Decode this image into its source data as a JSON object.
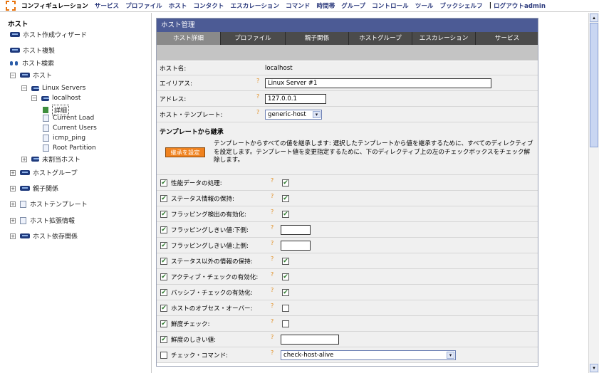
{
  "nav": {
    "items": [
      "コンフィギュレーション",
      "サービス",
      "プロファイル",
      "ホスト",
      "コンタクト",
      "エスカレーション",
      "コマンド",
      "時間帯",
      "グループ",
      "コントロール",
      "ツール",
      "ブックシェルフ"
    ],
    "logout": "ログアウトadmin"
  },
  "sidebar": {
    "title": "ホスト",
    "items": {
      "wizard": "ホスト作成ウィザード",
      "clone": "ホスト複製",
      "search": "ホスト検索",
      "host": "ホスト",
      "linux_servers": "Linux Servers",
      "localhost": "localhost",
      "detail": "詳細",
      "svc1": "Current Load",
      "svc2": "Current Users",
      "svc3": "icmp_ping",
      "svc4": "Root Partition",
      "unassigned": "未割当ホスト",
      "hostgroups": "ホストグループ",
      "parents": "親子関係",
      "templates": "ホストテンプレート",
      "extinfo": "ホスト拡張情報",
      "deps": "ホスト依存関係"
    }
  },
  "main": {
    "header": "ホスト管理",
    "tabs": [
      "ホスト詳細",
      "プロファイル",
      "親子関係",
      "ホストグループ",
      "エスカレーション",
      "サービス"
    ],
    "hostname_label": "ホスト名:",
    "hostname_value": "localhost",
    "alias_label": "エイリアス:",
    "alias_value": "Linux Server #1",
    "address_label": "アドレス:",
    "address_value": "127.0.0.1",
    "template_label": "ホスト・テンプレート:",
    "template_value": "generic-host",
    "inherit_title": "テンプレートから継承",
    "inherit_button": "継承を設定",
    "inherit_desc": "テンプレートからすべての値を継承します: 選択したテンプレートから値を継承するために、すべてのディレクティブを設定します。テンプレート値を変更指定するために、下のディレクティブ上の左のチェックボックスをチェック解除します。",
    "directives": [
      {
        "label": "性能データの処理:",
        "left": "✔",
        "right": "✔"
      },
      {
        "label": "ステータス情報の保持:",
        "left": "✔",
        "right": "✔"
      },
      {
        "label": "フラッピング検出の有効化:",
        "left": "✔",
        "right": "✔"
      },
      {
        "label": "フラッピングしきい値:下側:",
        "left": "✔",
        "right": ""
      },
      {
        "label": "フラッピングしきい値:上側:",
        "left": "✔",
        "right": ""
      },
      {
        "label": "ステータス以外の情報の保持:",
        "left": "✔",
        "right": "✔"
      },
      {
        "label": "アクティブ・チェックの有効化:",
        "left": "✔",
        "right": "✔"
      },
      {
        "label": "パッシブ・チェックの有効化:",
        "left": "✔",
        "right": "✔"
      },
      {
        "label": "ホストのオブセス・オーバー:",
        "left": "✔",
        "right": ""
      },
      {
        "label": "鮮度チェック:",
        "left": "✔",
        "right": ""
      },
      {
        "label": "鮮度のしきい値:",
        "left": "✔",
        "right": ""
      },
      {
        "label": "チェック・コマンド:",
        "left": "",
        "right": "check-host-alive"
      }
    ],
    "qmark": "?",
    "expand_plus": "+",
    "expand_minus": "−",
    "select_arrow": "▾",
    "scroll_up": "▴",
    "scroll_down": "▾"
  }
}
